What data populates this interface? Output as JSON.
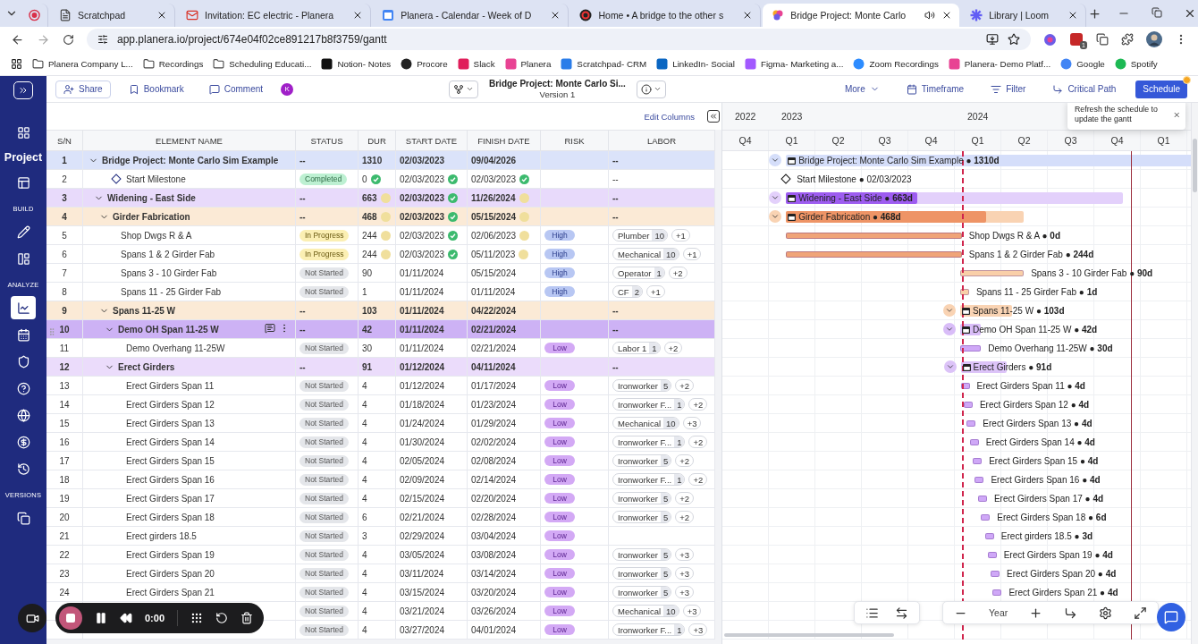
{
  "browser": {
    "tabs": [
      {
        "kind": "record",
        "selected": false,
        "audio": false
      },
      {
        "title": "Scratchpad",
        "kind": "doc",
        "selected": false,
        "audio": false
      },
      {
        "title": "Invitation: EC electric - Planera",
        "kind": "gmail",
        "selected": false,
        "audio": false
      },
      {
        "title": "Planera - Calendar - Week of D",
        "kind": "calendar",
        "selected": false,
        "audio": false
      },
      {
        "title": "Home • A bridge to the other s",
        "kind": "home",
        "selected": false,
        "audio": false
      },
      {
        "title": "Bridge Project: Monte Carlo",
        "kind": "planera",
        "selected": true,
        "audio": true
      },
      {
        "title": "Library | Loom",
        "kind": "loom",
        "selected": false,
        "audio": false
      }
    ],
    "url": "app.planera.io/project/674e04f02ce891217b8f3759/gantt",
    "extension_badge": "1",
    "bookmarks": [
      {
        "label": "Planera Company L...",
        "kind": "folder"
      },
      {
        "label": "Recordings",
        "kind": "folder"
      },
      {
        "label": "Scheduling Educati...",
        "kind": "folder"
      },
      {
        "label": "Notion- Notes",
        "kind": "notion"
      },
      {
        "label": "Procore",
        "kind": "procore"
      },
      {
        "label": "Slack",
        "kind": "slack"
      },
      {
        "label": "Planera",
        "kind": "planera"
      },
      {
        "label": "Scratchpad- CRM",
        "kind": "scratchpad"
      },
      {
        "label": "LinkedIn- Social",
        "kind": "linkedin"
      },
      {
        "label": "Figma- Marketing a...",
        "kind": "figma"
      },
      {
        "label": "Zoom Recordings",
        "kind": "zoom"
      },
      {
        "label": "Planera- Demo Platf...",
        "kind": "planera"
      },
      {
        "label": "Google",
        "kind": "google"
      },
      {
        "label": "Spotify",
        "kind": "spotify"
      }
    ]
  },
  "sidebar": {
    "items": [
      {
        "kind": "link",
        "selected": false
      },
      {
        "kind": "heading",
        "label": "Project"
      },
      {
        "kind": "link",
        "selected": false
      },
      {
        "kind": "section",
        "label": "BUILD"
      },
      {
        "kind": "link",
        "selected": false
      },
      {
        "kind": "link",
        "selected": false
      },
      {
        "kind": "section",
        "label": "ANALYZE"
      },
      {
        "kind": "link",
        "selected": true
      },
      {
        "kind": "link",
        "selected": false
      },
      {
        "kind": "link",
        "selected": false
      },
      {
        "kind": "link",
        "selected": false
      },
      {
        "kind": "link",
        "selected": false
      },
      {
        "kind": "link",
        "selected": false
      },
      {
        "kind": "link",
        "selected": false
      },
      {
        "kind": "section",
        "label": "VERSIONS"
      },
      {
        "kind": "link",
        "selected": false
      }
    ]
  },
  "toolbar": {
    "actions": [
      {
        "label": "Share"
      },
      {
        "label": "Bookmark"
      },
      {
        "label": "Comment"
      }
    ],
    "avatar": "K",
    "title": "Bridge Project: Monte Carlo Si...",
    "version": "Version 1",
    "right": [
      {
        "label": "More"
      },
      {
        "label": "Timeframe"
      },
      {
        "label": "Filter"
      },
      {
        "label": "Critical Path"
      }
    ],
    "primary": {
      "label": "Schedule",
      "badge": true
    }
  },
  "table": {
    "edit_columns": "Edit Columns",
    "columns": [
      "S/N",
      "ELEMENT NAME",
      "STATUS",
      "DUR",
      "START DATE",
      "FINISH DATE",
      "RISK",
      "LABOR"
    ],
    "rows": [
      {
        "sn": "1",
        "kind": "summary",
        "name": "Bridge Project: Monte Carlo Sim Example",
        "status": "--",
        "dur": "1310",
        "start": "02/03/2023",
        "finish": "09/04/2026",
        "labor": "--",
        "color": "#dbe3fa",
        "selected": false,
        "expanded": true,
        "bar": {
          "label": "Bridge Project: Monte Carlo Sim Example ● **1310d**",
          "color": "#d5defa"
        },
        "children": [
          {
            "sn": "2",
            "kind": "milestone",
            "name": "Start Milestone",
            "status": {
              "label": "Completed",
              "kind": "completed"
            },
            "dur": "0",
            "dur_on_time": true,
            "start": "02/03/2023",
            "start_on_time": true,
            "finish": "02/03/2023",
            "finish_on_time": true,
            "labor": "--",
            "selected": false,
            "bar": {
              "label": "Start Milestone ● 02/03/2023"
            }
          },
          {
            "sn": "3",
            "kind": "summary",
            "name": "Widening - East Side",
            "status": "--",
            "dur": "663",
            "dur_on_time": false,
            "start": "02/03/2023",
            "start_on_time": true,
            "finish": "11/26/2024",
            "finish_on_time": false,
            "labor": "--",
            "color": "#e8dafb",
            "selected": false,
            "expanded": true,
            "bar": {
              "label": "Widening - East Side ● **663d**",
              "color": "#e3d0fb",
              "progress": {
                "level": 0.39,
                "color": "#9d5cf0"
              }
            },
            "children": [
              {
                "sn": "4",
                "kind": "summary",
                "name": "Girder Fabrication",
                "status": "--",
                "dur": "468",
                "dur_on_time": false,
                "start": "02/03/2023",
                "start_on_time": true,
                "finish": "05/15/2024",
                "finish_on_time": false,
                "labor": "--",
                "color": "#fbead6",
                "selected": false,
                "expanded": true,
                "bar": {
                  "label": "Girder Fabrication ● **468d**",
                  "color": "#f9d3b3",
                  "progress": {
                    "level": 0.84,
                    "color": "#ee9466"
                  }
                },
                "children": [
                  {
                    "sn": "5",
                    "kind": "task",
                    "name": "Shop Dwgs R & A",
                    "status": {
                      "label": "In Progress",
                      "kind": "in_progress"
                    },
                    "dur": "244",
                    "dur_on_time": false,
                    "start": "02/03/2023",
                    "start_on_time": true,
                    "finish": "02/06/2023",
                    "finish_on_time": false,
                    "risk": {
                      "label": "High",
                      "kind": "high"
                    },
                    "labor": {
                      "name": "Plumber",
                      "count": "10",
                      "more": "+1"
                    },
                    "selected": false,
                    "bar": {
                      "label": "Shop Dwgs R & A ● **0d**",
                      "color": "#f0a478"
                    }
                  },
                  {
                    "sn": "6",
                    "kind": "task",
                    "name": "Spans 1 & 2 Girder Fab",
                    "status": {
                      "label": "In Progress",
                      "kind": "in_progress"
                    },
                    "dur": "244",
                    "dur_on_time": false,
                    "start": "02/03/2023",
                    "start_on_time": true,
                    "finish": "05/11/2023",
                    "finish_on_time": false,
                    "risk": {
                      "label": "High",
                      "kind": "high"
                    },
                    "labor": {
                      "name": "Mechanical",
                      "count": "10",
                      "more": "+1"
                    },
                    "selected": false,
                    "bar": {
                      "label": "Spans 1 & 2 Girder Fab ● **244d**",
                      "color": "#f0a478"
                    }
                  },
                  {
                    "sn": "7",
                    "kind": "task",
                    "name": "Spans 3 - 10 Girder Fab",
                    "status": {
                      "label": "Not Started",
                      "kind": "not_started"
                    },
                    "dur": "90",
                    "start": "01/11/2024",
                    "finish": "05/15/2024",
                    "risk": {
                      "label": "High",
                      "kind": "high"
                    },
                    "labor": {
                      "name": "Operator",
                      "count": "1",
                      "more": "+2"
                    },
                    "selected": false,
                    "bar": {
                      "label": "Spans 3 - 10 Girder Fab ● **90d**",
                      "color": "#f9cfa8"
                    }
                  },
                  {
                    "sn": "8",
                    "kind": "task",
                    "name": "Spans 11 - 25 Girder Fab",
                    "status": {
                      "label": "Not Started",
                      "kind": "not_started"
                    },
                    "dur": "1",
                    "start": "01/11/2024",
                    "finish": "01/11/2024",
                    "risk": {
                      "label": "High",
                      "kind": "high"
                    },
                    "labor": {
                      "name": "CF",
                      "count": "2",
                      "more": "+1"
                    },
                    "selected": false,
                    "bar": {
                      "label": "Spans 11 - 25 Girder Fab ● **1d**",
                      "color": "#f9cfa8"
                    }
                  }
                ]
              },
              {
                "sn": "9",
                "kind": "summary",
                "name": "Spans 11-25 W",
                "status": "--",
                "dur": "103",
                "start": "01/11/2024",
                "finish": "04/22/2024",
                "labor": "--",
                "color": "#fbead6",
                "selected": false,
                "expanded": true,
                "bar": {
                  "label": "Spans 11-25 W ● **103d**",
                  "color": "#f9d3b3"
                },
                "children": [
                  {
                    "sn": "10",
                    "kind": "summary",
                    "name": "Demo OH Span 11-25 W",
                    "status": "--",
                    "dur": "42",
                    "start": "01/11/2024",
                    "finish": "02/21/2024",
                    "labor": "--",
                    "color": "#e8dafb",
                    "selected": true,
                    "expanded": true,
                    "bar": {
                      "label": "Demo OH Span 11-25 W ● **42d**",
                      "color": "#d9bdf8"
                    },
                    "children": [
                      {
                        "sn": "11",
                        "kind": "task",
                        "name": "Demo Overhang 11-25W",
                        "status": {
                          "label": "Not Started",
                          "kind": "not_started"
                        },
                        "dur": "30",
                        "start": "01/11/2024",
                        "finish": "02/21/2024",
                        "risk": {
                          "label": "Low",
                          "kind": "low"
                        },
                        "labor": {
                          "name": "Labor 1",
                          "count": "1",
                          "more": "+2"
                        },
                        "selected": false,
                        "bar": {
                          "label": "Demo Overhang 11-25W ● **30d**",
                          "color": "#cfa8f7"
                        }
                      }
                    ]
                  },
                  {
                    "sn": "12",
                    "kind": "summary",
                    "name": "Erect Girders",
                    "status": "--",
                    "dur": "91",
                    "start": "01/12/2024",
                    "finish": "04/11/2024",
                    "labor": "--",
                    "color": "#ebdcfb",
                    "selected": false,
                    "expanded": true,
                    "bar": {
                      "label": "Erect Girders ● **91d**",
                      "color": "#dcc3f8"
                    },
                    "children": [
                      {
                        "sn": "13",
                        "kind": "task",
                        "name": "Erect Girders Span 11",
                        "status": {
                          "label": "Not Started",
                          "kind": "not_started"
                        },
                        "dur": "4",
                        "start": "01/12/2024",
                        "finish": "01/17/2024",
                        "risk": {
                          "label": "Low",
                          "kind": "low"
                        },
                        "labor": {
                          "name": "Ironworker",
                          "count": "5",
                          "more": "+2"
                        },
                        "selected": false,
                        "bar": {
                          "label": "Erect Girders Span 11 ● **4d**",
                          "color": "#cfa8f7"
                        }
                      },
                      {
                        "sn": "14",
                        "kind": "task",
                        "name": "Erect Girders Span 12",
                        "status": {
                          "label": "Not Started",
                          "kind": "not_started"
                        },
                        "dur": "4",
                        "start": "01/18/2024",
                        "finish": "01/23/2024",
                        "risk": {
                          "label": "Low",
                          "kind": "low"
                        },
                        "labor": {
                          "name": "Ironworker F...",
                          "count": "1",
                          "more": "+2"
                        },
                        "selected": false,
                        "bar": {
                          "label": "Erect Girders Span 12 ● **4d**",
                          "color": "#cfa8f7"
                        }
                      },
                      {
                        "sn": "15",
                        "kind": "task",
                        "name": "Erect Girders Span 13",
                        "status": {
                          "label": "Not Started",
                          "kind": "not_started"
                        },
                        "dur": "4",
                        "start": "01/24/2024",
                        "finish": "01/29/2024",
                        "risk": {
                          "label": "Low",
                          "kind": "low"
                        },
                        "labor": {
                          "name": "Mechanical",
                          "count": "10",
                          "more": "+3"
                        },
                        "selected": false,
                        "bar": {
                          "label": "Erect Girders Span 13 ● **4d**",
                          "color": "#cfa8f7"
                        }
                      },
                      {
                        "sn": "16",
                        "kind": "task",
                        "name": "Erect Girders Span 14",
                        "status": {
                          "label": "Not Started",
                          "kind": "not_started"
                        },
                        "dur": "4",
                        "start": "01/30/2024",
                        "finish": "02/02/2024",
                        "risk": {
                          "label": "Low",
                          "kind": "low"
                        },
                        "labor": {
                          "name": "Ironworker F...",
                          "count": "1",
                          "more": "+2"
                        },
                        "selected": false,
                        "bar": {
                          "label": "Erect Girders Span 14 ● **4d**",
                          "color": "#cfa8f7"
                        }
                      },
                      {
                        "sn": "17",
                        "kind": "task",
                        "name": "Erect Girders Span 15",
                        "status": {
                          "label": "Not Started",
                          "kind": "not_started"
                        },
                        "dur": "4",
                        "start": "02/05/2024",
                        "finish": "02/08/2024",
                        "risk": {
                          "label": "Low",
                          "kind": "low"
                        },
                        "labor": {
                          "name": "Ironworker",
                          "count": "5",
                          "more": "+2"
                        },
                        "selected": false,
                        "bar": {
                          "label": "Erect Girders Span 15 ● **4d**",
                          "color": "#cfa8f7"
                        }
                      },
                      {
                        "sn": "18",
                        "kind": "task",
                        "name": "Erect Girders Span 16",
                        "status": {
                          "label": "Not Started",
                          "kind": "not_started"
                        },
                        "dur": "4",
                        "start": "02/09/2024",
                        "finish": "02/14/2024",
                        "risk": {
                          "label": "Low",
                          "kind": "low"
                        },
                        "labor": {
                          "name": "Ironworker F...",
                          "count": "1",
                          "more": "+2"
                        },
                        "selected": false,
                        "bar": {
                          "label": "Erect Girders Span 16 ● **4d**",
                          "color": "#cfa8f7"
                        }
                      },
                      {
                        "sn": "19",
                        "kind": "task",
                        "name": "Erect Girders Span 17",
                        "status": {
                          "label": "Not Started",
                          "kind": "not_started"
                        },
                        "dur": "4",
                        "start": "02/15/2024",
                        "finish": "02/20/2024",
                        "risk": {
                          "label": "Low",
                          "kind": "low"
                        },
                        "labor": {
                          "name": "Ironworker",
                          "count": "5",
                          "more": "+2"
                        },
                        "selected": false,
                        "bar": {
                          "label": "Erect Girders Span 17 ● **4d**",
                          "color": "#cfa8f7"
                        }
                      },
                      {
                        "sn": "20",
                        "kind": "task",
                        "name": "Erect Girders Span 18",
                        "status": {
                          "label": "Not Started",
                          "kind": "not_started"
                        },
                        "dur": "6",
                        "start": "02/21/2024",
                        "finish": "02/28/2024",
                        "risk": {
                          "label": "Low",
                          "kind": "low"
                        },
                        "labor": {
                          "name": "Ironworker",
                          "count": "5",
                          "more": "+2"
                        },
                        "selected": false,
                        "bar": {
                          "label": "Erect Girders Span 18 ● **6d**",
                          "color": "#cfa8f7"
                        }
                      },
                      {
                        "sn": "21",
                        "kind": "task",
                        "name": "Erect girders 18.5",
                        "status": {
                          "label": "Not Started",
                          "kind": "not_started"
                        },
                        "dur": "3",
                        "start": "02/29/2024",
                        "finish": "03/04/2024",
                        "risk": {
                          "label": "Low",
                          "kind": "low"
                        },
                        "selected": false,
                        "bar": {
                          "label": "Erect girders 18.5 ● **3d**",
                          "color": "#cfa8f7"
                        }
                      },
                      {
                        "sn": "22",
                        "kind": "task",
                        "name": "Erect Girders Span 19",
                        "status": {
                          "label": "Not Started",
                          "kind": "not_started"
                        },
                        "dur": "4",
                        "start": "03/05/2024",
                        "finish": "03/08/2024",
                        "risk": {
                          "label": "Low",
                          "kind": "low"
                        },
                        "labor": {
                          "name": "Ironworker",
                          "count": "5",
                          "more": "+3"
                        },
                        "selected": false,
                        "bar": {
                          "label": "Erect Girders Span 19 ● **4d**",
                          "color": "#cfa8f7"
                        }
                      },
                      {
                        "sn": "23",
                        "kind": "task",
                        "name": "Erect Girders Span 20",
                        "status": {
                          "label": "Not Started",
                          "kind": "not_started"
                        },
                        "dur": "4",
                        "start": "03/11/2024",
                        "finish": "03/14/2024",
                        "risk": {
                          "label": "Low",
                          "kind": "low"
                        },
                        "labor": {
                          "name": "Ironworker",
                          "count": "5",
                          "more": "+3"
                        },
                        "selected": false,
                        "bar": {
                          "label": "Erect Girders Span 20 ● **4d**",
                          "color": "#cfa8f7"
                        }
                      },
                      {
                        "sn": "24",
                        "kind": "task",
                        "name": "Erect Girders Span 21",
                        "status": {
                          "label": "Not Started",
                          "kind": "not_started"
                        },
                        "dur": "4",
                        "start": "03/15/2024",
                        "finish": "03/20/2024",
                        "risk": {
                          "label": "Low",
                          "kind": "low"
                        },
                        "labor": {
                          "name": "Ironworker",
                          "count": "5",
                          "more": "+3"
                        },
                        "selected": false,
                        "bar": {
                          "label": "Erect Girders Span 21 ● **4d**",
                          "color": "#cfa8f7"
                        }
                      },
                      {
                        "kind": "task",
                        "status": {
                          "label": "Not Started",
                          "kind": "not_started"
                        },
                        "dur": "4",
                        "start": "03/21/2024",
                        "finish": "03/26/2024",
                        "risk": {
                          "label": "Low",
                          "kind": "low"
                        },
                        "labor": {
                          "name": "Mechanical",
                          "count": "10",
                          "more": "+3"
                        },
                        "selected": false
                      },
                      {
                        "kind": "task",
                        "status": {
                          "label": "Not Started",
                          "kind": "not_started"
                        },
                        "dur": "4",
                        "start": "03/27/2024",
                        "finish": "04/01/2024",
                        "risk": {
                          "label": "Low",
                          "kind": "low"
                        },
                        "labor": {
                          "name": "Ironworker F...",
                          "count": "1",
                          "more": "+3"
                        },
                        "selected": false
                      }
                    ]
                  }
                ]
              }
            ]
          }
        ]
      }
    ]
  },
  "gantt": {
    "years": [
      {
        "label": "2022",
        "quarters": [
          "Q4"
        ]
      },
      {
        "label": "2023",
        "quarters": [
          "Q1",
          "Q2",
          "Q3",
          "Q4"
        ]
      },
      {
        "label": "2024",
        "quarters": [
          "Q1",
          "Q2",
          "Q3",
          "Q4"
        ]
      },
      {
        "quarters": [
          "Q1"
        ]
      }
    ],
    "markers": [
      {
        "kind": "today",
        "level": 0.515
      },
      {
        "kind": "deadline",
        "level": 0.879
      }
    ],
    "tooltip": "Refresh the schedule to update the gantt",
    "zoom_label": "Year"
  },
  "recorder": {
    "time": "0:00"
  }
}
